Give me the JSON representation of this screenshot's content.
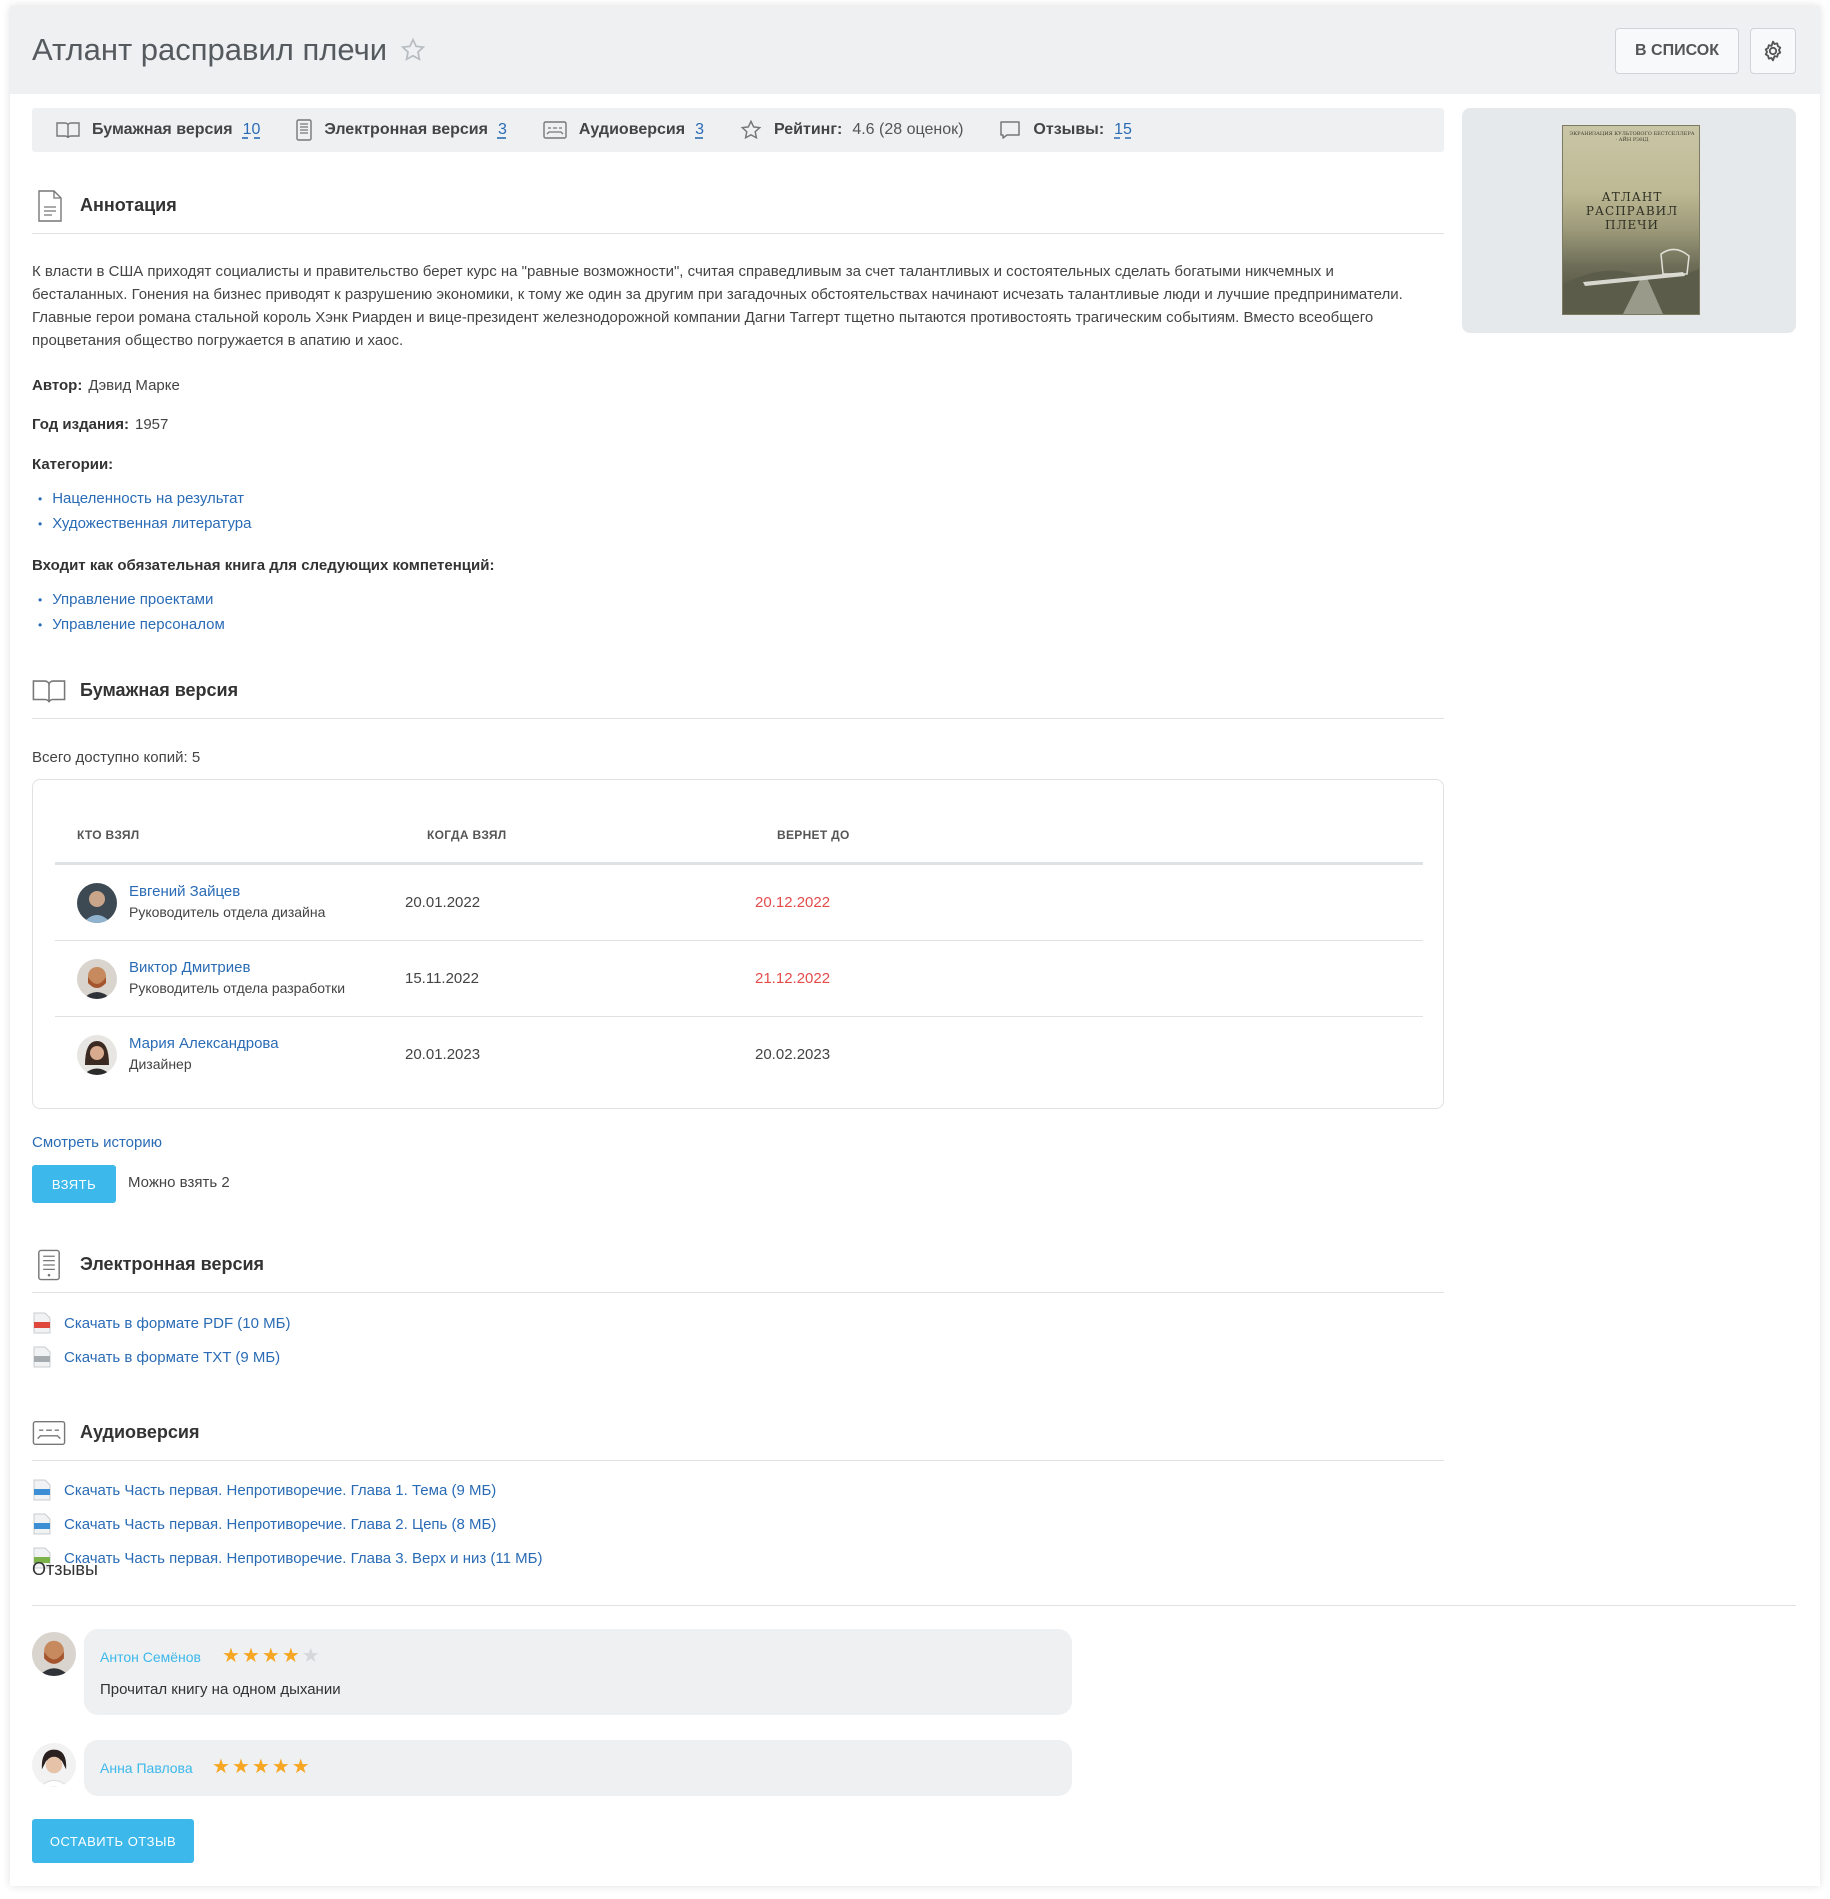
{
  "header": {
    "title": "Атлант расправил плечи",
    "list_button": "В список"
  },
  "stats": {
    "paper_label": "Бумажная версия",
    "paper_value": "10",
    "ebook_label": "Электронная версия",
    "ebook_value": "3",
    "audio_label": "Аудиоверсия",
    "audio_value": "3",
    "rating_label": "Рейтинг:",
    "rating_value": "4.6 (28 оценок)",
    "reviews_label": "Отзывы:",
    "reviews_value": "15"
  },
  "cover": {
    "subtitle": "ЭКРАНИЗАЦИЯ КУЛЬТОВОГО БЕСТСЕЛЛЕРА · АЙН РЭНД",
    "title_line1": "АТЛАНТ",
    "title_line2": "РАСПРАВИЛ",
    "title_line3": "ПЛЕЧИ"
  },
  "annotation": {
    "heading": "Аннотация",
    "text": "К власти в США приходят социалисты и правительство берет курс на \"равные возможности\", считая справедливым за счет талантливых и состоятельных сделать богатыми никчемных и бесталанных. Гонения на бизнес приводят к разрушению экономики, к тому же один за другим при загадочных обстоятельствах начинают исчезать талантливые люди и лучшие предприниматели. Главные герои романа стальной король Хэнк Риарден и вице-президент железнодорожной компании Дагни Таггерт тщетно пытаются противостоять трагическим событиям. Вместо всеобщего процветания общество погружается в апатию и хаос.",
    "author_label": "Автор:",
    "author": "Дэвид Марке",
    "year_label": "Год издания:",
    "year": "1957",
    "categories_label": "Категории:",
    "categories": [
      "Нацеленность на результат",
      "Художественная литература"
    ],
    "competencies_label": "Входит как обязательная книга для следующих компетенций:",
    "competencies": [
      "Управление проектами",
      "Управление персоналом"
    ]
  },
  "paper": {
    "heading": "Бумажная версия",
    "copies": "Всего доступно копий: 5",
    "columns": [
      "Кто взял",
      "Когда взял",
      "Вернет до"
    ],
    "rows": [
      {
        "name": "Евгений Зайцев",
        "role": "Руководитель отдела дизайна",
        "taken": "20.01.2022",
        "due": "20.12.2022"
      },
      {
        "name": "Виктор Дмитриев",
        "role": "Руководитель отдела разработки",
        "taken": "15.11.2022",
        "due": "21.12.2022"
      },
      {
        "name": "Мария Александрова",
        "role": "Дизайнер",
        "taken": "20.01.2023",
        "due": "20.02.2023"
      }
    ],
    "history_link": "Смотреть историю",
    "take_button": "Взять",
    "can_take": "Можно взять 2"
  },
  "ebook": {
    "heading": "Электронная версия",
    "files": [
      "Скачать в формате PDF (10 МБ)",
      "Скачать в формате TXT (9 МБ)"
    ]
  },
  "audio": {
    "heading": "Аудиоверсия",
    "files": [
      "Скачать Часть первая. Непротиворечие. Глава 1. Тема (9 МБ)",
      "Скачать Часть первая. Непротиворечие. Глава 2. Цепь (8 МБ)",
      "Скачать Часть первая. Непротиворечие. Глава 3. Верх и низ (11 МБ)"
    ]
  },
  "reviews": {
    "heading": "Отзывы",
    "items": [
      {
        "name": "Антон Семёнов",
        "stars": 4,
        "text": "Прочитал книгу на одном дыхании"
      },
      {
        "name": "Анна Павлова",
        "stars": 5,
        "text": ""
      }
    ],
    "leave_button": "Оставить отзыв"
  },
  "colors": {
    "accent": "#3cb8ea",
    "link": "#2a6bb5",
    "overdue": "#e54b4b",
    "star": "#f6a623"
  }
}
